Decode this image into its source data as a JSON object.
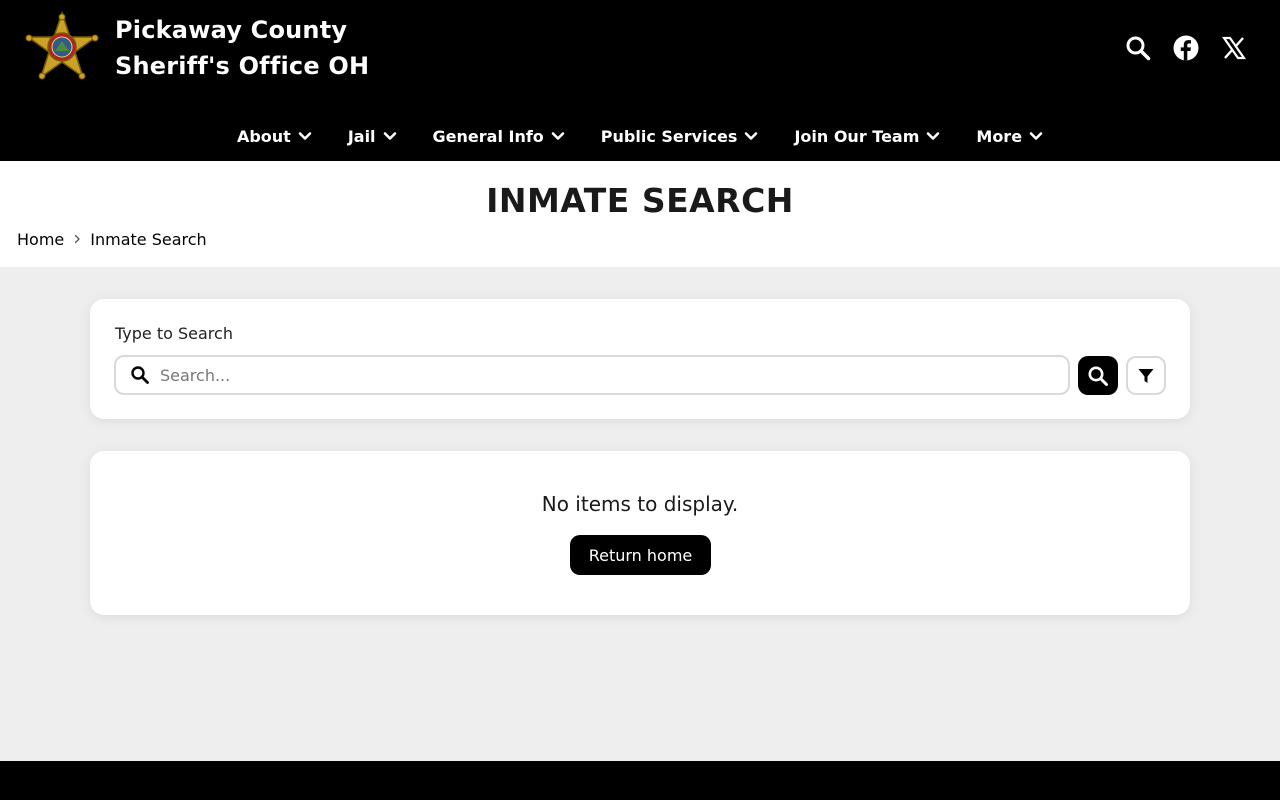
{
  "header": {
    "title_line1": "Pickaway County",
    "title_line2": "Sheriff's Office OH",
    "icons": [
      "search-icon",
      "facebook-icon",
      "x-twitter-icon"
    ]
  },
  "nav": {
    "items": [
      {
        "label": "About"
      },
      {
        "label": "Jail"
      },
      {
        "label": "General Info"
      },
      {
        "label": "Public Services"
      },
      {
        "label": "Join Our Team"
      },
      {
        "label": "More"
      }
    ]
  },
  "page": {
    "title": "INMATE SEARCH",
    "breadcrumb": [
      "Home",
      "Inmate Search"
    ]
  },
  "search": {
    "label": "Type to Search",
    "placeholder": "Search...",
    "value": ""
  },
  "results": {
    "empty_message": "No items to display.",
    "return_label": "Return home"
  },
  "colors": {
    "header_bg": "#000000",
    "page_bg": "#eeeeee",
    "accent": "#000000",
    "badge_gold": "#c9a227"
  }
}
